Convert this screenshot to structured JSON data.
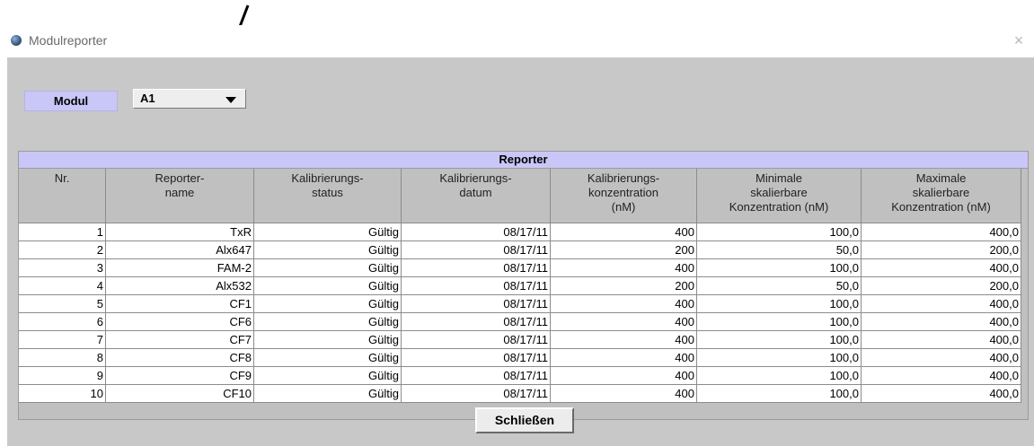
{
  "window": {
    "title": "Modulreporter",
    "close_glyph": "×"
  },
  "modul": {
    "label": "Modul",
    "selected": "A1"
  },
  "table": {
    "caption": "Reporter",
    "columns": [
      "Nr.",
      "Reporter-\nname",
      "Kalibrierungs-\nstatus",
      "Kalibrierungs-\ndatum",
      "Kalibrierungs-\nkonzentration\n(nM)",
      "Minimale\nskalierbare\nKonzentration (nM)",
      "Maximale\nskalierbare\nKonzentration (nM)"
    ],
    "rows": [
      [
        "1",
        "TxR",
        "Gültig",
        "08/17/11",
        "400",
        "100,0",
        "400,0"
      ],
      [
        "2",
        "Alx647",
        "Gültig",
        "08/17/11",
        "200",
        "50,0",
        "200,0"
      ],
      [
        "3",
        "FAM-2",
        "Gültig",
        "08/17/11",
        "400",
        "100,0",
        "400,0"
      ],
      [
        "4",
        "Alx532",
        "Gültig",
        "08/17/11",
        "200",
        "50,0",
        "200,0"
      ],
      [
        "5",
        "CF1",
        "Gültig",
        "08/17/11",
        "400",
        "100,0",
        "400,0"
      ],
      [
        "6",
        "CF6",
        "Gültig",
        "08/17/11",
        "400",
        "100,0",
        "400,0"
      ],
      [
        "7",
        "CF7",
        "Gültig",
        "08/17/11",
        "400",
        "100,0",
        "400,0"
      ],
      [
        "8",
        "CF8",
        "Gültig",
        "08/17/11",
        "400",
        "100,0",
        "400,0"
      ],
      [
        "9",
        "CF9",
        "Gültig",
        "08/17/11",
        "400",
        "100,0",
        "400,0"
      ],
      [
        "10",
        "CF10",
        "Gültig",
        "08/17/11",
        "400",
        "100,0",
        "400,0"
      ]
    ]
  },
  "buttons": {
    "close_label": "Schließen"
  },
  "colors": {
    "accent_lavender": "#c9c7f7",
    "panel_gray": "#c8c8c8"
  }
}
